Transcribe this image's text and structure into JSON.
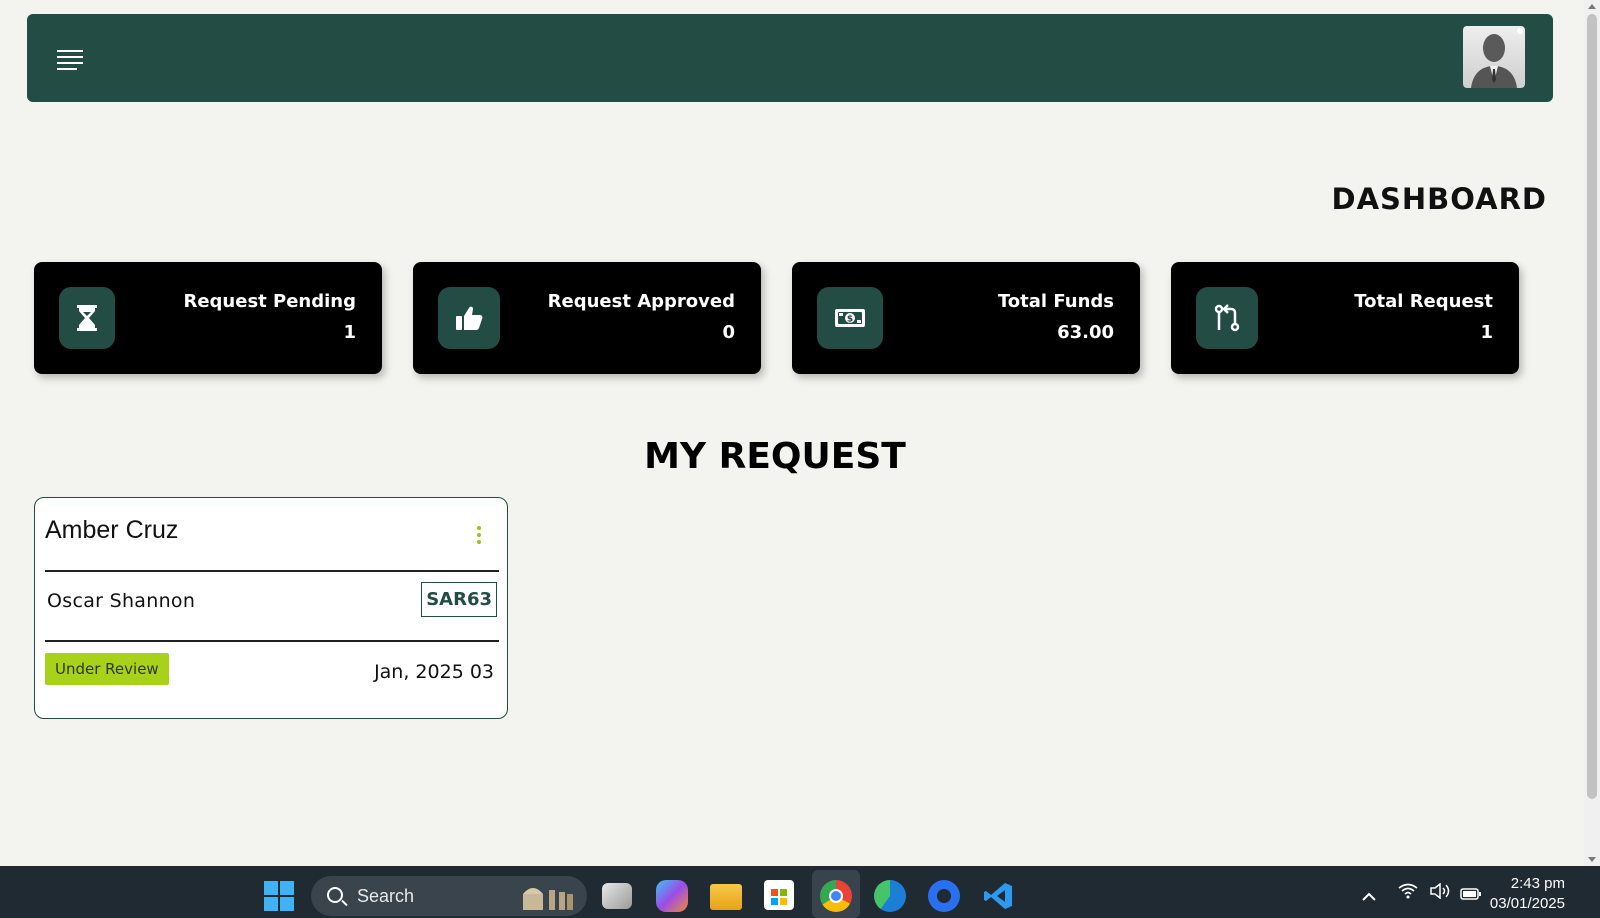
{
  "header": {
    "menu_icon": "hamburger-menu-icon",
    "avatar_icon": "user-avatar-icon"
  },
  "dashboard": {
    "title": "DASHBOARD",
    "stats": [
      {
        "label": "Request Pending",
        "value": "1",
        "icon": "hourglass-icon"
      },
      {
        "label": "Request Approved",
        "value": "0",
        "icon": "thumbs-up-icon"
      },
      {
        "label": "Total Funds",
        "value": "63.00",
        "icon": "money-bill-icon"
      },
      {
        "label": "Total Request",
        "value": "1",
        "icon": "code-pull-request-icon"
      }
    ]
  },
  "requests": {
    "title": "MY REQUEST",
    "items": [
      {
        "name": "Amber Cruz",
        "subtitle": "Oscar Shannon",
        "code": "SAR63",
        "status": "Under Review",
        "date": "Jan, 2025 03"
      }
    ]
  },
  "taskbar": {
    "search_placeholder": "Search",
    "time": "2:43 pm",
    "date": "03/01/2025"
  },
  "colors": {
    "primary": "#234c45",
    "card": "#000000",
    "accent": "#a8d11a",
    "background": "#f3f3ef"
  }
}
